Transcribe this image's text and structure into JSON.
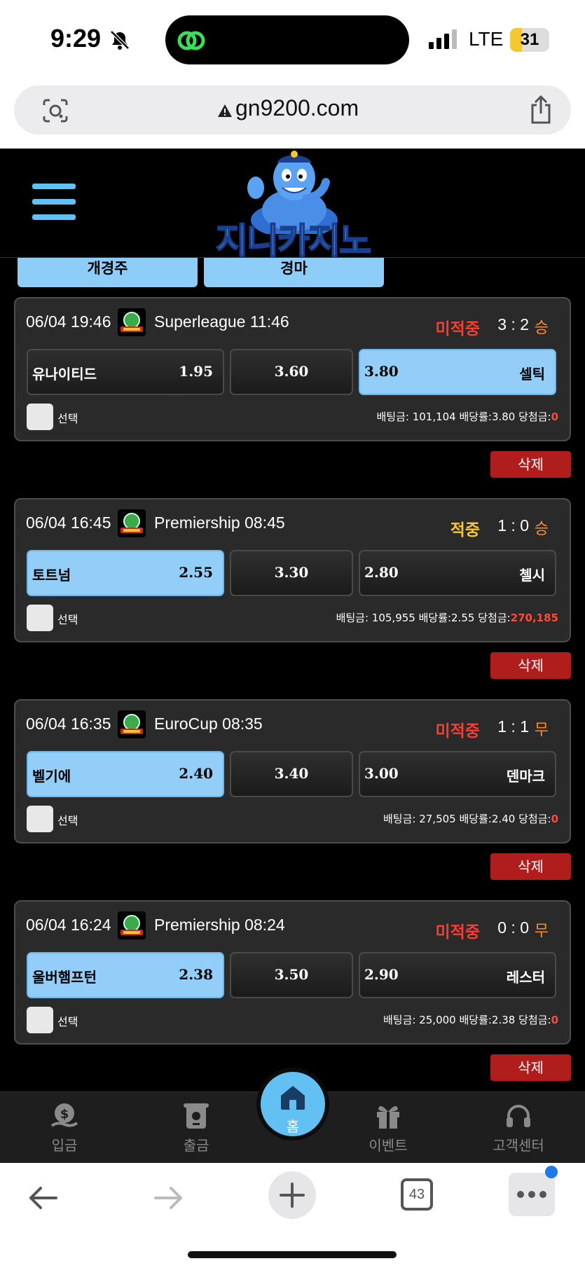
{
  "status_bar": {
    "time": "9:29",
    "network": "LTE",
    "battery": "31",
    "battery_level": 0.31
  },
  "browser": {
    "url": "gn9200.com",
    "tab_count": "43"
  },
  "site": {
    "logo_text": "지니카지노"
  },
  "tabs": [
    {
      "label": "개경주"
    },
    {
      "label": "경마"
    }
  ],
  "bets": [
    {
      "date": "06/04 19:46",
      "league": "Superleague 11:46",
      "status": "미적중",
      "status_color": "#ff3b30",
      "score": "3 : 2",
      "result": "승",
      "home_team": "유나이티드",
      "home_odds": "1.95",
      "draw_odds": "3.60",
      "away_odds": "3.80",
      "away_team": "셀틱",
      "selected": "away",
      "select_label": "선택",
      "bet_text": "배팅금: 101,104 배당률:3.80 당첨금:",
      "win_amount": "0",
      "delete_label": "삭제"
    },
    {
      "date": "06/04 16:45",
      "league": "Premiership 08:45",
      "status": "적중",
      "status_color": "#f5c830",
      "score": "1 : 0",
      "result": "승",
      "home_team": "토트넘",
      "home_odds": "2.55",
      "draw_odds": "3.30",
      "away_odds": "2.80",
      "away_team": "첼시",
      "selected": "home",
      "select_label": "선택",
      "bet_text": "배팅금: 105,955 배당률:2.55 당첨금:",
      "win_amount": "270,185",
      "delete_label": "삭제"
    },
    {
      "date": "06/04 16:35",
      "league": "EuroCup 08:35",
      "status": "미적중",
      "status_color": "#ff3b30",
      "score": "1 : 1",
      "result": "무",
      "home_team": "벨기에",
      "home_odds": "2.40",
      "draw_odds": "3.40",
      "away_odds": "3.00",
      "away_team": "덴마크",
      "selected": "home",
      "select_label": "선택",
      "bet_text": "배팅금: 27,505 배당률:2.40 당첨금:",
      "win_amount": "0",
      "delete_label": "삭제"
    },
    {
      "date": "06/04 16:24",
      "league": "Premiership 08:24",
      "status": "미적중",
      "status_color": "#ff3b30",
      "score": "0 : 0",
      "result": "무",
      "home_team": "울버햄프턴",
      "home_odds": "2.38",
      "draw_odds": "3.50",
      "away_odds": "2.90",
      "away_team": "레스터",
      "selected": "home",
      "select_label": "선택",
      "bet_text": "배팅금: 25,000 배당률:2.38 당첨금:",
      "win_amount": "0",
      "delete_label": "삭제"
    }
  ],
  "bottom_nav": [
    {
      "label": "입금",
      "icon": "deposit-icon"
    },
    {
      "label": "출금",
      "icon": "withdraw-icon"
    },
    {
      "label": "홈",
      "icon": "home-icon"
    },
    {
      "label": "이벤트",
      "icon": "gift-icon"
    },
    {
      "label": "고객센터",
      "icon": "headset-icon"
    }
  ]
}
